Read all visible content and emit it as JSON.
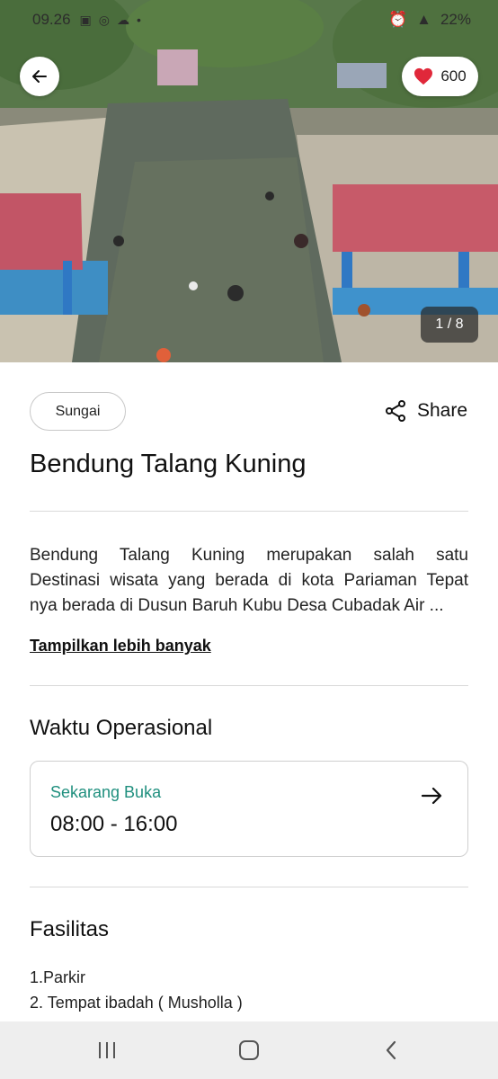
{
  "status_bar": {
    "time": "09.26",
    "battery": "22%"
  },
  "hero": {
    "like_count": "600",
    "photo_counter": "1 / 8"
  },
  "header": {
    "category": "Sungai",
    "share_label": "Share",
    "title": "Bendung Talang Kuning"
  },
  "description": {
    "lines": [
      "Bendung Talang Kuning merupakan salah satu",
      "Destinasi wisata yang berada di kota Pariaman Tepat",
      "nya berada di Dusun Baruh Kubu Desa Cubadak Air ..."
    ],
    "show_more": "Tampilkan lebih banyak"
  },
  "operational": {
    "title": "Waktu Operasional",
    "status": "Sekarang Buka",
    "hours": "08:00 - 16:00"
  },
  "facilities": {
    "title": "Fasilitas",
    "items": [
      "1.Parkir",
      "2. Tempat ibadah ( Musholla )"
    ]
  },
  "colors": {
    "accent_open": "#1f8f7e",
    "heart": "#e0283a"
  },
  "icons": {
    "back": "arrow-left-icon",
    "like": "heart-icon",
    "share": "share-icon",
    "card_arrow": "arrow-right-icon"
  }
}
